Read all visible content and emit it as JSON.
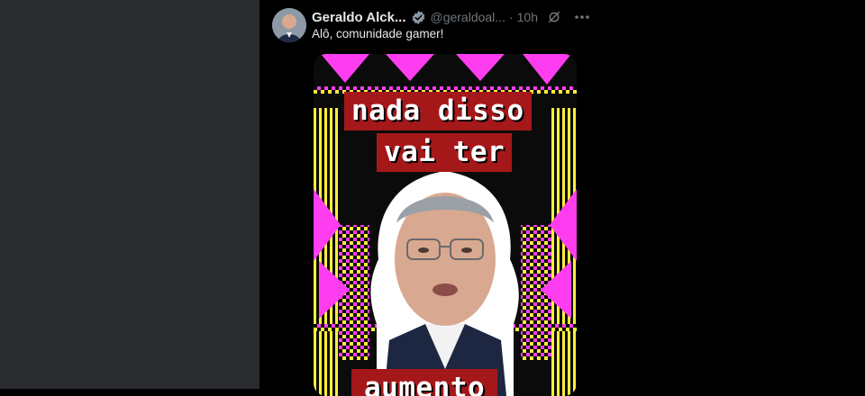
{
  "tweet": {
    "author_name": "Geraldo Alck...",
    "handle": "@geraldoal...",
    "separator": "·",
    "time": "10h",
    "text": "Alô, comunidade gamer!"
  },
  "media": {
    "caption_lines": [
      "nada disso",
      "vai ter",
      "aumento"
    ]
  },
  "icons": {
    "verified": "verified-badge-icon",
    "grok": "grok-icon",
    "more": "more-options-icon"
  },
  "colors": {
    "background": "#000000",
    "left_panel": "#2a2b2e",
    "text_primary": "#e7e9ea",
    "text_secondary": "#71767b",
    "caption_bg": "#a5181a",
    "pattern_pink": "#ff3df0",
    "pattern_yellow": "#ffef3a"
  }
}
